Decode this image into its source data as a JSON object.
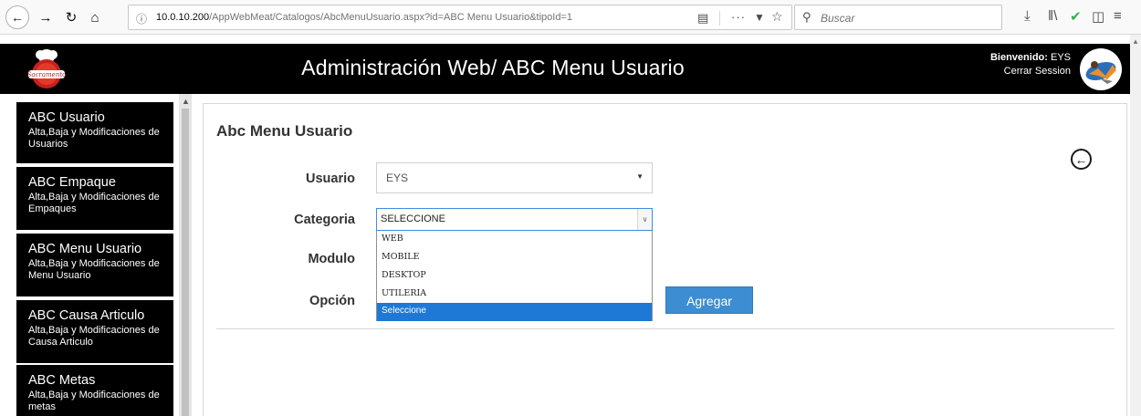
{
  "browser": {
    "url_prefix": "10.0.10.200",
    "url_path": "/AppWebMeat/Catalogos/AbcMenuUsuario.aspx?id=ABC Menu Usuario&tipoId=1",
    "search_placeholder": "Buscar"
  },
  "header": {
    "title": "Administración Web/ ABC Menu Usuario",
    "welcome_label": "Bienvenido:",
    "user": "EYS",
    "logout_label": "Cerrar Session",
    "logo_text": "Sacramento"
  },
  "sidebar": {
    "items": [
      {
        "title": "ABC Usuario",
        "desc": "Alta,Baja y Modificaciones de Usuarios"
      },
      {
        "title": "ABC Empaque",
        "desc": "Alta,Baja y Modificaciones de Empaques"
      },
      {
        "title": "ABC Menu Usuario",
        "desc": "Alta,Baja y Modificaciones de Menu Usuario"
      },
      {
        "title": "ABC Causa Articulo",
        "desc": "Alta,Baja y Modificaciones de Causa Articulo"
      },
      {
        "title": "ABC Metas",
        "desc": "Alta,Baja y Modificaciones de metas"
      }
    ]
  },
  "form": {
    "title": "Abc Menu Usuario",
    "usuario_label": "Usuario",
    "usuario_value": "EYS",
    "categoria_label": "Categoria",
    "categoria_value": "SELECCIONE",
    "categoria_options": [
      "WEB",
      "MOBILE",
      "DESKTOP",
      "UTILERIA",
      "Seleccione"
    ],
    "categoria_highlighted": "Seleccione",
    "modulo_label": "Modulo",
    "opcion_label": "Opción",
    "add_label": "Agregar"
  },
  "colors": {
    "header_bg": "#000000",
    "sidebar_item_bg": "#000000",
    "accent": "#3c8dd2",
    "dropdown_highlight": "#1e78d6"
  },
  "icons": {
    "back": "circle-arrow-left-icon",
    "nav_back": "browser-back-icon",
    "reload": "reload-icon",
    "home": "home-icon",
    "info": "info-icon",
    "reader": "reader-view-icon",
    "bookmark": "star-icon",
    "pocket": "pocket-icon",
    "download": "download-icon",
    "library": "library-icon",
    "extension": "extension-check-icon",
    "sidebar_toggle": "sidebar-toggle-icon",
    "menu": "hamburger-menu-icon"
  }
}
